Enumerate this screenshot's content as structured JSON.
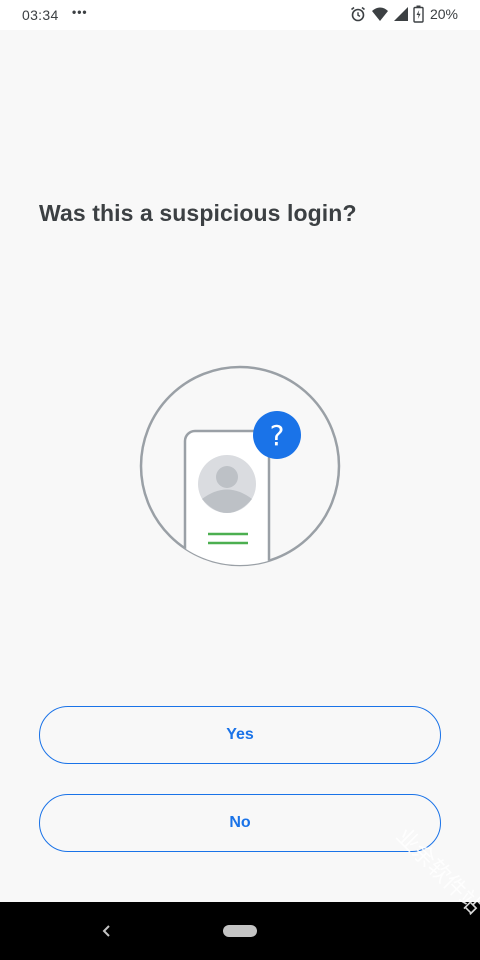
{
  "status_bar": {
    "time": "03:34",
    "dots": "•••",
    "battery": "20%",
    "icons": [
      "alarm-icon",
      "wifi-icon",
      "cellular-signal-icon",
      "battery-icon"
    ]
  },
  "main": {
    "title": "Was this a suspicious login?",
    "illustration": {
      "icon": "phone-question-illustration",
      "badge_glyph": "?"
    },
    "yes_label": "Yes",
    "no_label": "No"
  },
  "nav_bar": {
    "icons": [
      "back-icon",
      "home-pill-icon"
    ]
  },
  "watermark": "业余软件站",
  "colors": {
    "accent": "#1a73e8",
    "title_text": "#3c4043",
    "background": "#f8f8f8",
    "illustration_line": "#9aa0a6",
    "avatar_bg": "#dadce0",
    "avatar_figure": "#bdc1c6",
    "green_lines": "#4caf50",
    "nav_bar": "#000000"
  }
}
